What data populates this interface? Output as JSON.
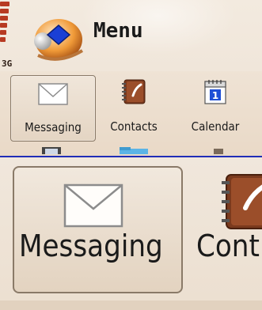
{
  "status": {
    "network": "3G"
  },
  "header": {
    "title": "Menu"
  },
  "menu": {
    "items": [
      {
        "label": "Messaging",
        "icon": "envelope-icon",
        "selected": true
      },
      {
        "label": "Contacts",
        "icon": "address-book-icon",
        "selected": false
      },
      {
        "label": "Calendar",
        "icon": "calendar-icon",
        "selected": false
      }
    ],
    "calendar_day": "1"
  },
  "zoom": {
    "messaging_label": "Messaging",
    "contacts_label_partial": "Cont"
  },
  "colors": {
    "accent_border": "#1f2db8",
    "signal": "#b73a22"
  }
}
